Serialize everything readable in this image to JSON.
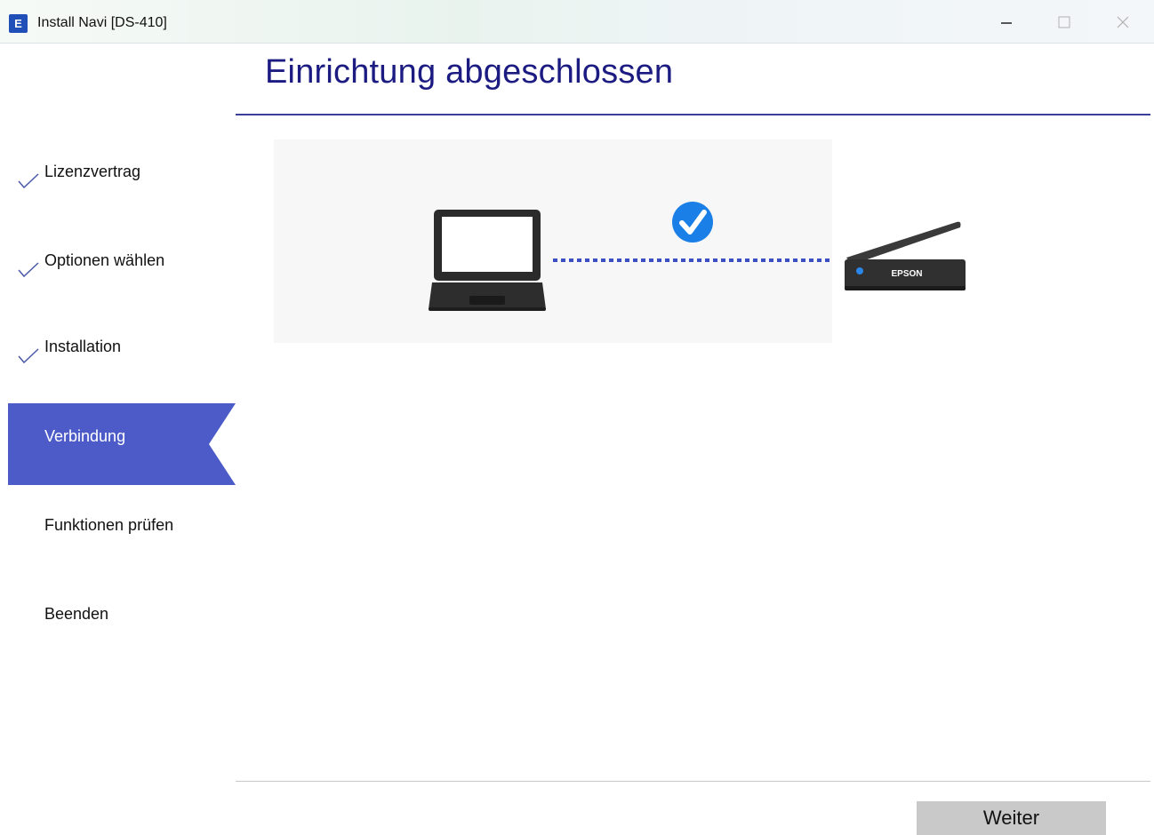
{
  "window": {
    "title": "Install Navi [DS-410]",
    "icon_letter": "E",
    "controls": [
      "minimize",
      "maximize",
      "close"
    ]
  },
  "header": {
    "title": "Einrichtung abgeschlossen"
  },
  "sidebar": {
    "steps": [
      {
        "label": "Lizenzvertrag",
        "state": "completed"
      },
      {
        "label": "Optionen wählen",
        "state": "completed"
      },
      {
        "label": "Installation",
        "state": "completed"
      },
      {
        "label": "Verbindung",
        "state": "active"
      },
      {
        "label": "Funktionen prüfen",
        "state": "pending"
      },
      {
        "label": "Beenden",
        "state": "pending"
      }
    ]
  },
  "illustration": {
    "scanner_brand": "EPSON",
    "connection_status": "connected",
    "icons": [
      "laptop-icon",
      "check-circle-icon",
      "scanner-icon"
    ]
  },
  "footer": {
    "next_label": "Weiter"
  },
  "colors": {
    "title": "#1b1b82",
    "accent": "#4c5bc8",
    "check": "#1a7fe6",
    "dotted_line": "#3b4fc4"
  }
}
